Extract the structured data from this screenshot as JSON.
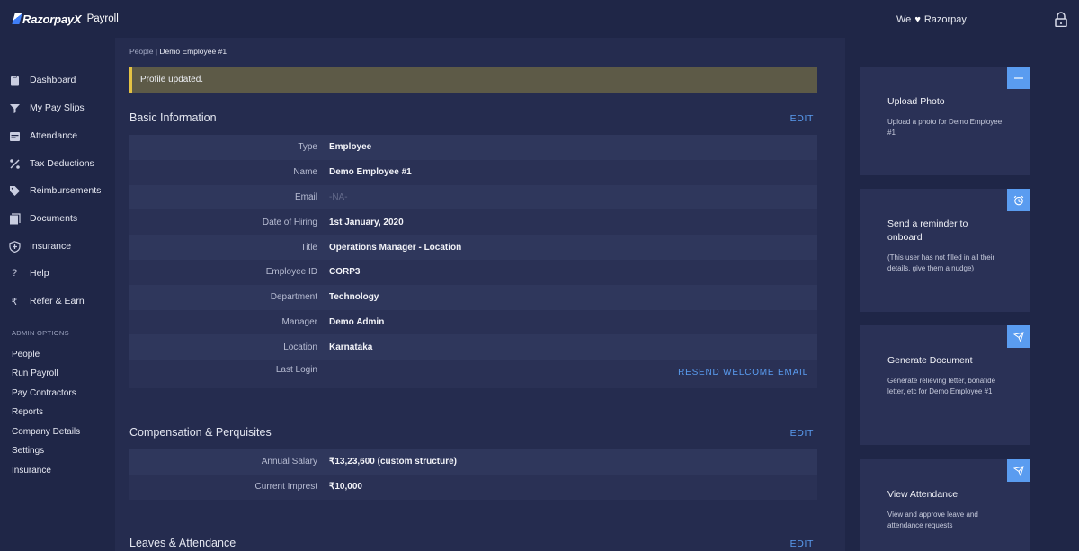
{
  "topbar": {
    "brand": "Razorpay",
    "brand_x": "X",
    "product": "Payroll",
    "tagline_pre": "We",
    "tagline_heart": "♥",
    "tagline_post": "Razorpay"
  },
  "sidebar": {
    "items": [
      {
        "label": "Dashboard",
        "icon": "clipboard-icon"
      },
      {
        "label": "My Pay Slips",
        "icon": "payslip-icon"
      },
      {
        "label": "Attendance",
        "icon": "calendar-icon"
      },
      {
        "label": "Tax Deductions",
        "icon": "percent-icon"
      },
      {
        "label": "Reimbursements",
        "icon": "tag-icon"
      },
      {
        "label": "Documents",
        "icon": "documents-icon"
      },
      {
        "label": "Insurance",
        "icon": "shield-icon"
      },
      {
        "label": "Help",
        "icon": "question-icon"
      },
      {
        "label": "Refer & Earn",
        "icon": "rupee-icon"
      }
    ],
    "admin_title": "ADMIN OPTIONS",
    "admin_items": [
      "People",
      "Run Payroll",
      "Pay Contractors",
      "Reports",
      "Company Details",
      "Settings",
      "Insurance"
    ]
  },
  "main": {
    "breadcrumb_root": "People",
    "breadcrumb_sep": " | ",
    "breadcrumb_current": "Demo Employee #1",
    "alert": "Profile updated.",
    "basic": {
      "title": "Basic Information",
      "edit": "EDIT",
      "rows": [
        {
          "label": "Type",
          "value": "Employee"
        },
        {
          "label": "Name",
          "value": "Demo Employee #1"
        },
        {
          "label": "Email",
          "value": "-NA-"
        },
        {
          "label": "Date of Hiring",
          "value": "1st January, 2020"
        },
        {
          "label": "Title",
          "value": "Operations Manager - Location"
        },
        {
          "label": "Employee ID",
          "value": "CORP3"
        },
        {
          "label": "Department",
          "value": "Technology"
        },
        {
          "label": "Manager",
          "value": "Demo Admin"
        },
        {
          "label": "Location",
          "value": "Karnataka"
        },
        {
          "label": "Last Login",
          "value": ""
        }
      ],
      "resend": "RESEND WELCOME EMAIL"
    },
    "compensation": {
      "title": "Compensation & Perquisites",
      "edit": "EDIT",
      "rows": [
        {
          "label": "Annual Salary",
          "value": "₹13,23,600 (custom structure)"
        },
        {
          "label": "Current Imprest",
          "value": "₹10,000"
        }
      ]
    },
    "leaves": {
      "title": "Leaves & Attendance",
      "edit": "EDIT"
    }
  },
  "cards": [
    {
      "title": "Upload Photo",
      "desc": "Upload a photo for Demo Employee #1",
      "icon": "minus-icon"
    },
    {
      "title": "Send a reminder to onboard",
      "desc": "(This user has not filled in all their details, give them a nudge)",
      "icon": "alarm-clock-icon"
    },
    {
      "title": "Generate Document",
      "desc": "Generate relieving letter, bonafide letter, etc for Demo Employee #1",
      "icon": "send-icon"
    },
    {
      "title": "View Attendance",
      "desc": "View and approve leave and attendance requests",
      "icon": "send-icon"
    }
  ],
  "colors": {
    "background": "#1f2647",
    "panel": "#252c4f",
    "accent": "#5a9cf0",
    "alert_border": "#e4c244"
  }
}
